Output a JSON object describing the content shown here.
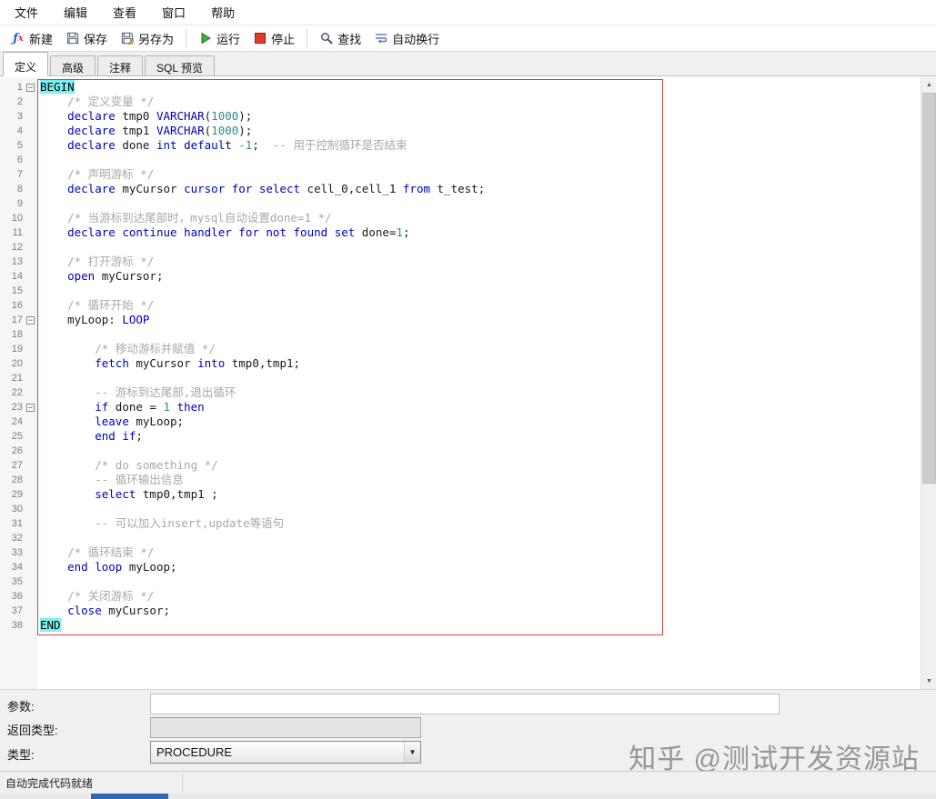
{
  "menubar": {
    "items": [
      "文件",
      "编辑",
      "查看",
      "窗口",
      "帮助"
    ]
  },
  "toolbar": {
    "new_icon": "fx",
    "new_label": "新建",
    "save_label": "保存",
    "save_as_label": "另存为",
    "run_label": "运行",
    "stop_label": "停止",
    "find_label": "查找",
    "word_wrap_label": "自动换行"
  },
  "tabs": [
    {
      "label": "定义",
      "active": true
    },
    {
      "label": "高级",
      "active": false
    },
    {
      "label": "注释",
      "active": false
    },
    {
      "label": "SQL 预览",
      "active": false
    }
  ],
  "editor": {
    "colors": {
      "keyword": "#0000BB",
      "comment": "#A8A8A8",
      "number": "#2E8B8B",
      "plain": "#1A1A1A",
      "highlight_bg": "#7DEFEF",
      "selection_border": "#C84B3C"
    },
    "lines": [
      {
        "n": 1,
        "fold": true,
        "seg": [
          [
            "hl",
            "BEGIN"
          ]
        ]
      },
      {
        "n": 2,
        "seg": [
          [
            "p",
            "    "
          ],
          [
            "c",
            "/* 定义变量 */"
          ]
        ]
      },
      {
        "n": 3,
        "seg": [
          [
            "p",
            "    "
          ],
          [
            "k",
            "declare"
          ],
          [
            "p",
            " tmp0 "
          ],
          [
            "k",
            "VARCHAR"
          ],
          [
            "p",
            "("
          ],
          [
            "n",
            "1000"
          ],
          [
            "p",
            ");"
          ]
        ]
      },
      {
        "n": 4,
        "seg": [
          [
            "p",
            "    "
          ],
          [
            "k",
            "declare"
          ],
          [
            "p",
            " tmp1 "
          ],
          [
            "k",
            "VARCHAR"
          ],
          [
            "p",
            "("
          ],
          [
            "n",
            "1000"
          ],
          [
            "p",
            ");"
          ]
        ]
      },
      {
        "n": 5,
        "seg": [
          [
            "p",
            "    "
          ],
          [
            "k",
            "declare"
          ],
          [
            "p",
            " done "
          ],
          [
            "k",
            "int"
          ],
          [
            "p",
            " "
          ],
          [
            "k",
            "default"
          ],
          [
            "p",
            " "
          ],
          [
            "n",
            "-1"
          ],
          [
            "p",
            ";  "
          ],
          [
            "c",
            "-- 用于控制循环是否结束"
          ]
        ]
      },
      {
        "n": 6,
        "seg": []
      },
      {
        "n": 7,
        "seg": [
          [
            "p",
            "    "
          ],
          [
            "c",
            "/* 声明游标 */"
          ]
        ]
      },
      {
        "n": 8,
        "seg": [
          [
            "p",
            "    "
          ],
          [
            "k",
            "declare"
          ],
          [
            "p",
            " myCursor "
          ],
          [
            "k",
            "cursor"
          ],
          [
            "p",
            " "
          ],
          [
            "k",
            "for"
          ],
          [
            "p",
            " "
          ],
          [
            "k",
            "select"
          ],
          [
            "p",
            " cell_0,cell_1 "
          ],
          [
            "k",
            "from"
          ],
          [
            "p",
            " t_test;"
          ]
        ]
      },
      {
        "n": 9,
        "seg": []
      },
      {
        "n": 10,
        "seg": [
          [
            "p",
            "    "
          ],
          [
            "c",
            "/* 当游标到达尾部时，mysql自动设置done=1 */"
          ]
        ]
      },
      {
        "n": 11,
        "seg": [
          [
            "p",
            "    "
          ],
          [
            "k",
            "declare"
          ],
          [
            "p",
            " "
          ],
          [
            "k",
            "continue"
          ],
          [
            "p",
            " "
          ],
          [
            "k",
            "handler"
          ],
          [
            "p",
            " "
          ],
          [
            "k",
            "for"
          ],
          [
            "p",
            " "
          ],
          [
            "k",
            "not"
          ],
          [
            "p",
            " "
          ],
          [
            "k",
            "found"
          ],
          [
            "p",
            " "
          ],
          [
            "k",
            "set"
          ],
          [
            "p",
            " done="
          ],
          [
            "n",
            "1"
          ],
          [
            "p",
            ";"
          ]
        ]
      },
      {
        "n": 12,
        "seg": []
      },
      {
        "n": 13,
        "seg": [
          [
            "p",
            "    "
          ],
          [
            "c",
            "/* 打开游标 */"
          ]
        ]
      },
      {
        "n": 14,
        "seg": [
          [
            "p",
            "    "
          ],
          [
            "k",
            "open"
          ],
          [
            "p",
            " myCursor;"
          ]
        ]
      },
      {
        "n": 15,
        "seg": []
      },
      {
        "n": 16,
        "seg": [
          [
            "p",
            "    "
          ],
          [
            "c",
            "/* 循环开始 */"
          ]
        ]
      },
      {
        "n": 17,
        "fold": true,
        "seg": [
          [
            "p",
            "    myLoop: "
          ],
          [
            "k",
            "LOOP"
          ]
        ]
      },
      {
        "n": 18,
        "seg": []
      },
      {
        "n": 19,
        "seg": [
          [
            "p",
            "        "
          ],
          [
            "c",
            "/* 移动游标并赋值 */"
          ]
        ]
      },
      {
        "n": 20,
        "seg": [
          [
            "p",
            "        "
          ],
          [
            "k",
            "fetch"
          ],
          [
            "p",
            " myCursor "
          ],
          [
            "k",
            "into"
          ],
          [
            "p",
            " tmp0,tmp1;"
          ]
        ]
      },
      {
        "n": 21,
        "seg": []
      },
      {
        "n": 22,
        "seg": [
          [
            "p",
            "        "
          ],
          [
            "c",
            "-- 游标到达尾部,退出循环"
          ]
        ]
      },
      {
        "n": 23,
        "fold": true,
        "seg": [
          [
            "p",
            "        "
          ],
          [
            "k",
            "if"
          ],
          [
            "p",
            " done = "
          ],
          [
            "n",
            "1"
          ],
          [
            "p",
            " "
          ],
          [
            "k",
            "then"
          ]
        ]
      },
      {
        "n": 24,
        "seg": [
          [
            "p",
            "        "
          ],
          [
            "k",
            "leave"
          ],
          [
            "p",
            " myLoop;"
          ]
        ]
      },
      {
        "n": 25,
        "seg": [
          [
            "p",
            "        "
          ],
          [
            "k",
            "end"
          ],
          [
            "p",
            " "
          ],
          [
            "k",
            "if"
          ],
          [
            "p",
            ";"
          ]
        ]
      },
      {
        "n": 26,
        "seg": []
      },
      {
        "n": 27,
        "seg": [
          [
            "p",
            "        "
          ],
          [
            "c",
            "/* do something */"
          ]
        ]
      },
      {
        "n": 28,
        "seg": [
          [
            "p",
            "        "
          ],
          [
            "c",
            "-- 循环输出信息"
          ]
        ]
      },
      {
        "n": 29,
        "seg": [
          [
            "p",
            "        "
          ],
          [
            "k",
            "select"
          ],
          [
            "p",
            " tmp0,tmp1 ;"
          ]
        ]
      },
      {
        "n": 30,
        "seg": []
      },
      {
        "n": 31,
        "seg": [
          [
            "p",
            "        "
          ],
          [
            "c",
            "-- 可以加入insert,update等语句"
          ]
        ]
      },
      {
        "n": 32,
        "seg": []
      },
      {
        "n": 33,
        "seg": [
          [
            "p",
            "    "
          ],
          [
            "c",
            "/* 循环结束 */"
          ]
        ]
      },
      {
        "n": 34,
        "seg": [
          [
            "p",
            "    "
          ],
          [
            "k",
            "end"
          ],
          [
            "p",
            " "
          ],
          [
            "k",
            "loop"
          ],
          [
            "p",
            " myLoop;"
          ]
        ]
      },
      {
        "n": 35,
        "seg": []
      },
      {
        "n": 36,
        "seg": [
          [
            "p",
            "    "
          ],
          [
            "c",
            "/* 关闭游标 */"
          ]
        ]
      },
      {
        "n": 37,
        "seg": [
          [
            "p",
            "    "
          ],
          [
            "k",
            "close"
          ],
          [
            "p",
            " myCursor;"
          ]
        ]
      },
      {
        "n": 38,
        "seg": [
          [
            "hl",
            "END"
          ]
        ]
      }
    ]
  },
  "form": {
    "params_label": "参数:",
    "params_value": "",
    "return_type_label": "返回类型:",
    "return_type_value": "",
    "type_label": "类型:",
    "type_value": "PROCEDURE"
  },
  "statusbar": {
    "text": "自动完成代码就绪"
  },
  "watermark": "知乎 @测试开发资源站"
}
